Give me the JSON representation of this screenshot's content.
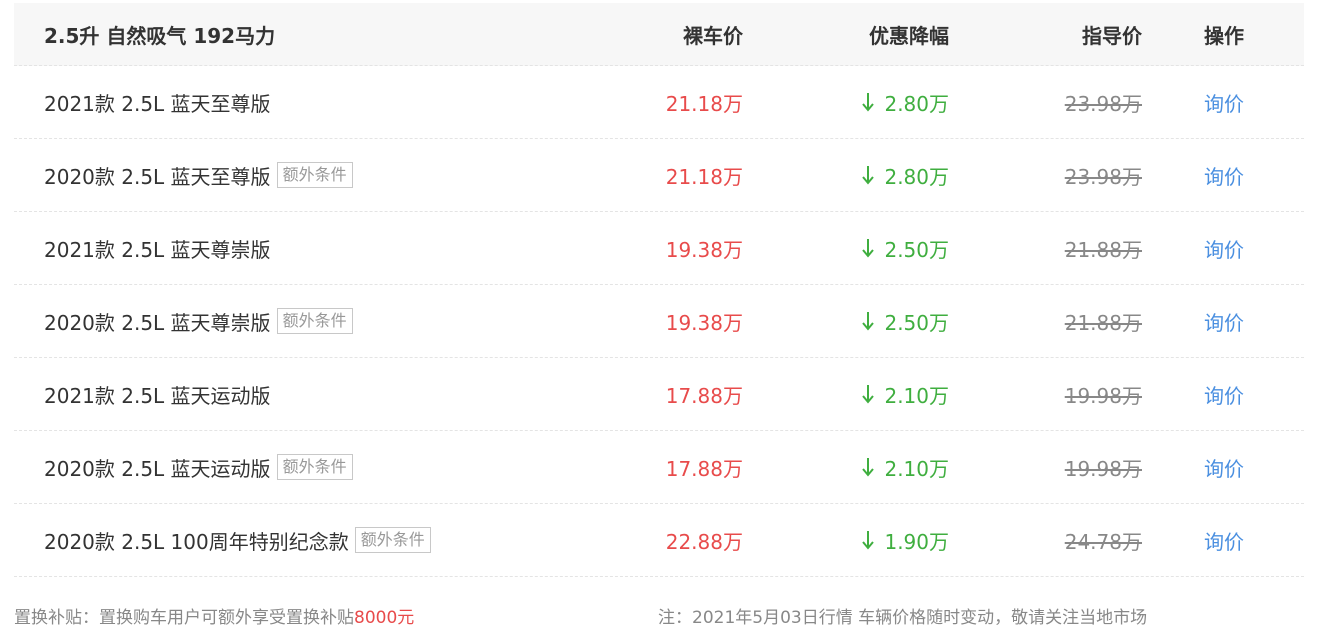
{
  "header": {
    "engine": "2.5升 自然吸气 192马力",
    "col_price": "裸车价",
    "col_discount": "优惠降幅",
    "col_guide": "指导价",
    "col_action": "操作"
  },
  "rows": [
    {
      "name": "2021款 2.5L 蓝天至尊版",
      "tag": "",
      "price": "21.18万",
      "discount": "2.80万",
      "guide": "23.98万",
      "action": "询价"
    },
    {
      "name": "2020款 2.5L 蓝天至尊版",
      "tag": "额外条件",
      "price": "21.18万",
      "discount": "2.80万",
      "guide": "23.98万",
      "action": "询价"
    },
    {
      "name": "2021款 2.5L 蓝天尊崇版",
      "tag": "",
      "price": "19.38万",
      "discount": "2.50万",
      "guide": "21.88万",
      "action": "询价"
    },
    {
      "name": "2020款 2.5L 蓝天尊崇版",
      "tag": "额外条件",
      "price": "19.38万",
      "discount": "2.50万",
      "guide": "21.88万",
      "action": "询价"
    },
    {
      "name": "2021款 2.5L 蓝天运动版",
      "tag": "",
      "price": "17.88万",
      "discount": "2.10万",
      "guide": "19.98万",
      "action": "询价"
    },
    {
      "name": "2020款 2.5L 蓝天运动版",
      "tag": "额外条件",
      "price": "17.88万",
      "discount": "2.10万",
      "guide": "19.98万",
      "action": "询价"
    },
    {
      "name": "2020款 2.5L 100周年特别纪念款",
      "tag": "额外条件",
      "price": "22.88万",
      "discount": "1.90万",
      "guide": "24.78万",
      "action": "询价"
    }
  ],
  "footer": {
    "subsidy_text": "置换补贴：置换购车用户可额外享受置换补贴",
    "subsidy_amount": "8000元",
    "note": "注：2021年5月03日行情 车辆价格随时变动，敬请关注当地市场"
  },
  "colors": {
    "price": "#e84b4b",
    "discount": "#3fae3f",
    "action": "#4a8fe0",
    "guide": "#888888"
  },
  "icons": {
    "discount": "down-arrow-icon"
  }
}
